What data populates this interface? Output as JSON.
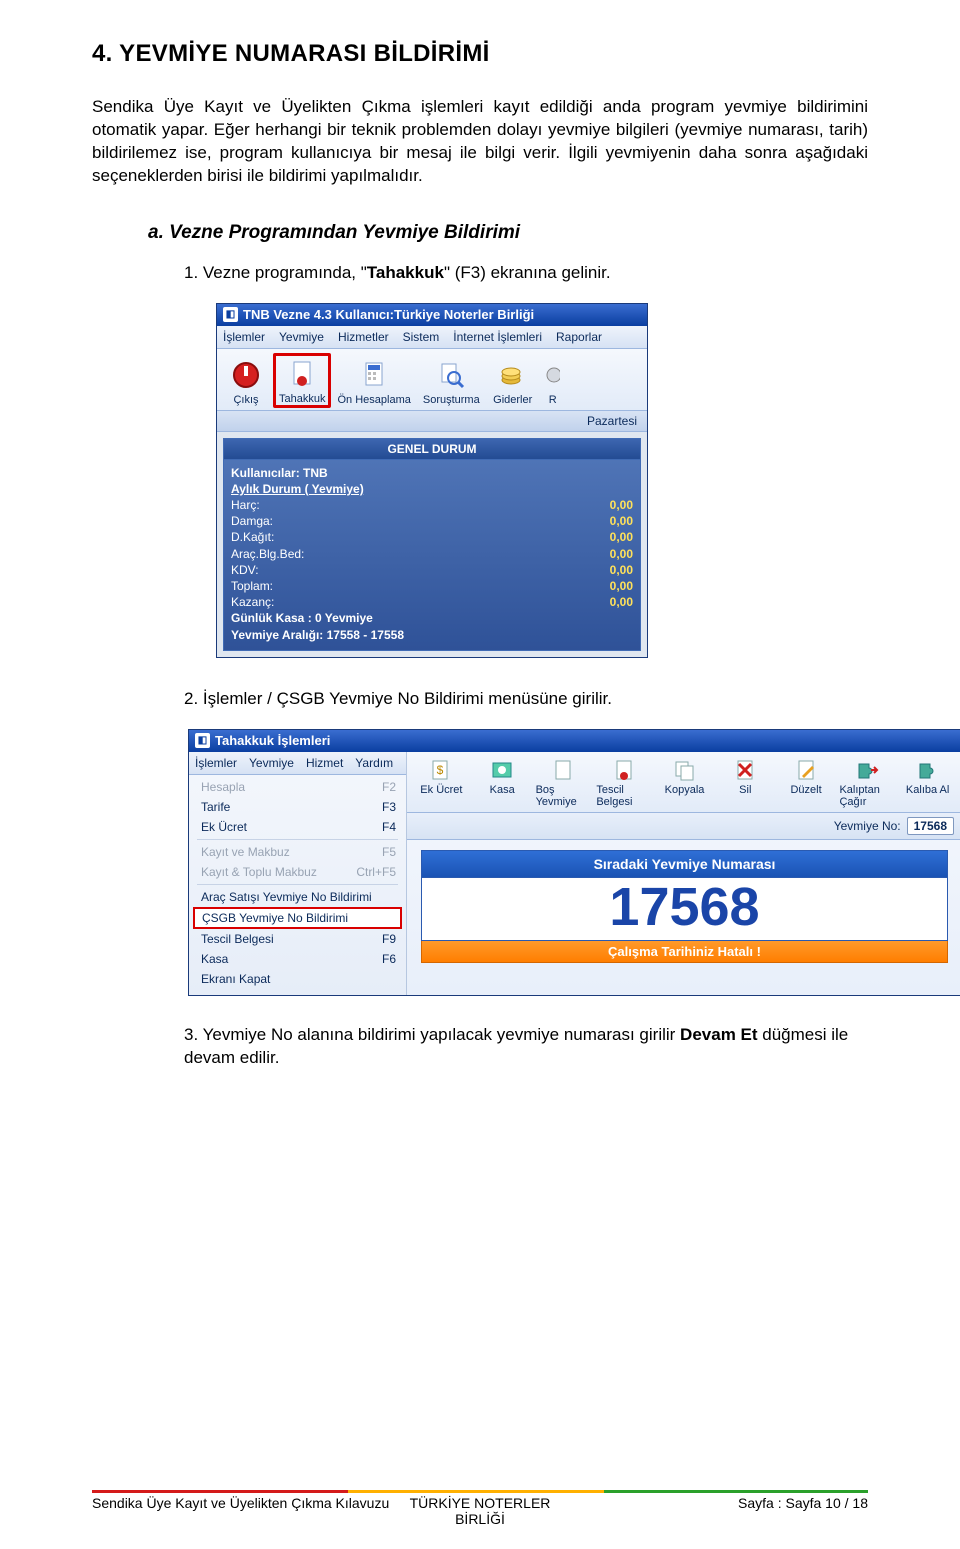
{
  "section": {
    "title": "4. YEVMİYE NUMARASI BİLDİRİMİ",
    "p1": "Sendika Üye Kayıt ve Üyelikten Çıkma işlemleri kayıt edildiği anda program yevmiye bildirimini otomatik yapar. Eğer herhangi bir teknik problemden dolayı yevmiye bilgileri (yevmiye numarası, tarih) bildirilemez ise, program kullanıcıya bir mesaj ile bilgi verir. İlgili yevmiyenin daha sonra aşağıdaki seçeneklerden birisi ile bildirimi yapılmalıdır.",
    "sub_a": "a. Vezne Programından Yevmiye Bildirimi",
    "li1_pre": "1. Vezne programında, \"",
    "li1_b": "Tahakkuk",
    "li1_post": "\" (F3) ekranına gelinir.",
    "li2": "2. İşlemler / ÇSGB Yevmiye No Bildirimi menüsüne girilir.",
    "li3_pre": "3. Yevmiye No alanına bildirimi yapılacak yevmiye numarası girilir ",
    "li3_b": "Devam Et",
    "li3_post": " düğmesi ile devam edilir."
  },
  "shot1": {
    "title": "TNB Vezne 4.3  Kullanıcı:Türkiye Noterler Birliği",
    "menus": [
      "İşlemler",
      "Yevmiye",
      "Hizmetler",
      "Sistem",
      "İnternet İşlemleri",
      "Raporlar"
    ],
    "toolbar": [
      {
        "label": "Çıkış",
        "icon": "power"
      },
      {
        "label": "Tahakkuk",
        "icon": "doc",
        "highlight": true
      },
      {
        "label": "Ön Hesaplama",
        "icon": "calc"
      },
      {
        "label": "Soruşturma",
        "icon": "search"
      },
      {
        "label": "Giderler",
        "icon": "coins"
      },
      {
        "label": "R",
        "icon": "gear",
        "partial": true
      }
    ],
    "day": "Pazartesi",
    "panel_title": "GENEL DURUM",
    "panel_sub1": "Kullanıcılar: TNB",
    "panel_sub2": "Aylık Durum ( Yevmiye)",
    "rows": [
      {
        "k": "Harç:",
        "v": "0,00"
      },
      {
        "k": "Damga:",
        "v": "0,00"
      },
      {
        "k": "D.Kağıt:",
        "v": "0,00"
      },
      {
        "k": "Araç.Blg.Bed:",
        "v": "0,00"
      },
      {
        "k": "KDV:",
        "v": "0,00"
      },
      {
        "k": "Toplam:",
        "v": "0,00"
      },
      {
        "k": "Kazanç:",
        "v": "0,00"
      }
    ],
    "gunluk": "Günlük Kasa   : 0 Yevmiye",
    "aralik": "Yevmiye Aralığı: 17558 - 17558"
  },
  "shot2": {
    "title": "Tahakkuk İşlemleri",
    "menus": [
      "İşlemler",
      "Yevmiye",
      "Hizmet",
      "Yardım"
    ],
    "menulist": [
      {
        "label": "Hesapla",
        "sc": "F2",
        "cls": "disabled"
      },
      {
        "label": "Tarife",
        "sc": "F3",
        "cls": "dark"
      },
      {
        "label": "Ek Ücret",
        "sc": "F4",
        "cls": "dark"
      },
      {
        "sep": true
      },
      {
        "label": "Kayıt ve Makbuz",
        "sc": "F5",
        "cls": "disabled"
      },
      {
        "label": "Kayıt & Toplu Makbuz",
        "sc": "Ctrl+F5",
        "cls": "disabled"
      },
      {
        "sep": true
      },
      {
        "label": "Araç Satışı Yevmiye No Bildirimi",
        "sc": "",
        "cls": "dark"
      },
      {
        "label": "ÇSGB Yevmiye No Bildirimi",
        "sc": "",
        "cls": "highlight"
      },
      {
        "label": "Tescil Belgesi",
        "sc": "F9",
        "cls": "dark"
      },
      {
        "label": "Kasa",
        "sc": "F6",
        "cls": "dark"
      },
      {
        "label": "Ekranı Kapat",
        "sc": "",
        "cls": "dark"
      }
    ],
    "toolbar": [
      "Ek Ücret",
      "Kasa",
      "Boş Yevmiye",
      "Tescil Belgesi",
      "Kopyala",
      "Sil",
      "Düzelt",
      "Kalıptan Çağır",
      "Kalıba Al"
    ],
    "valrow_label": "Yevmiye No:",
    "valrow_value": "17568",
    "big_label": "Sıradaki Yevmiye Numarası",
    "big_num": "17568",
    "warn": "Çalışma Tarihiniz Hatalı !"
  },
  "footer": {
    "center": "TÜRKİYE NOTERLER BİRLİĞİ",
    "left": "Sendika Üye Kayıt ve Üyelikten Çıkma Kılavuzu",
    "right": "Sayfa : Sayfa 10 / 18"
  }
}
